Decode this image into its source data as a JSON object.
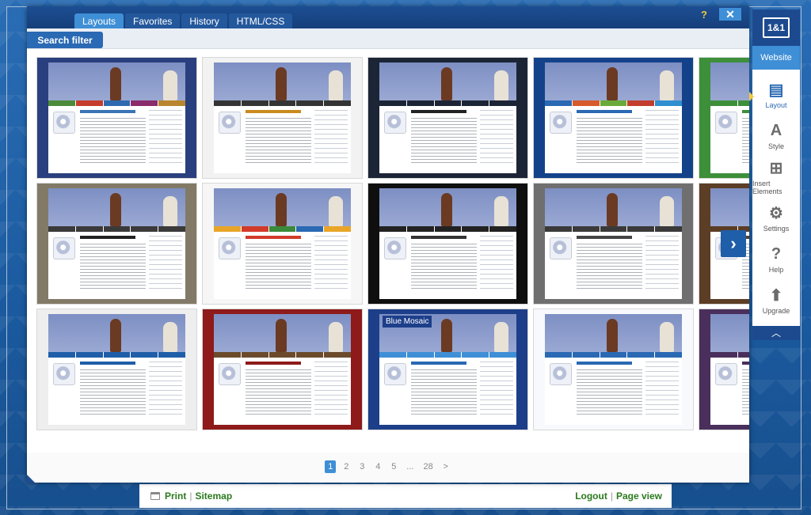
{
  "dialog": {
    "tabs": [
      {
        "label": "Layouts"
      },
      {
        "label": "Favorites"
      },
      {
        "label": "History"
      },
      {
        "label": "HTML/CSS"
      }
    ],
    "help_label": "?",
    "close_label": "✕",
    "search_filter_label": "Search filter",
    "next_arrow": "›"
  },
  "templates": [
    {
      "row": 0,
      "col": 0,
      "bg": "#2a3f7e",
      "nav": [
        "#4b8a3a",
        "#c43c2c",
        "#2f6ab0",
        "#8a2b6b",
        "#b7862e"
      ],
      "accent": "#3b74b5"
    },
    {
      "row": 0,
      "col": 1,
      "bg": "#f2f2f2",
      "nav": [
        "#343434",
        "#343434",
        "#343434",
        "#343434",
        "#343434"
      ],
      "accent": "#c98b1e"
    },
    {
      "row": 0,
      "col": 2,
      "bg": "#1c2536",
      "nav": [
        "#1c2536",
        "#1c2536",
        "#1c2536",
        "#1c2536",
        "#1c2536"
      ],
      "accent": "#222222"
    },
    {
      "row": 0,
      "col": 3,
      "bg": "#14428a",
      "nav": [
        "#2a69b3",
        "#d65a2b",
        "#6aaa3a",
        "#c23d2c",
        "#2f8fd0"
      ],
      "accent": "#2a69b3"
    },
    {
      "row": 0,
      "col": 4,
      "bg": "#3d8f3a",
      "nav": [
        "#3d8f3a",
        "#3d8f3a",
        "#3d8f3a",
        "#3d8f3a",
        "#3d8f3a"
      ],
      "accent": "#3d8f3a"
    },
    {
      "row": 1,
      "col": 0,
      "bg": "#827a67",
      "nav": [
        "#3a3a3a",
        "#3a3a3a",
        "#3a3a3a",
        "#3a3a3a",
        "#3a3a3a"
      ],
      "accent": "#222222"
    },
    {
      "row": 1,
      "col": 1,
      "bg": "#f6f6f6",
      "nav": [
        "#e8a528",
        "#d23a2a",
        "#3a8a3a",
        "#2a69b3",
        "#e8a528"
      ],
      "accent": "#d23a2a"
    },
    {
      "row": 1,
      "col": 2,
      "bg": "#0f0f0f",
      "nav": [
        "#222222",
        "#222222",
        "#222222",
        "#222222",
        "#222222"
      ],
      "accent": "#333333"
    },
    {
      "row": 1,
      "col": 3,
      "bg": "#6f6f6f",
      "nav": [
        "#3a3a3a",
        "#3a3a3a",
        "#3a3a3a",
        "#3a3a3a",
        "#3a3a3a"
      ],
      "accent": "#444444"
    },
    {
      "row": 1,
      "col": 4,
      "bg": "#5c3d25",
      "nav": [
        "#5c3d25",
        "#5c3d25",
        "#5c3d25",
        "#5c3d25",
        "#5c3d25"
      ],
      "accent": "#5c3d25"
    },
    {
      "row": 2,
      "col": 0,
      "bg": "#eeeeee",
      "nav": [
        "#1f5ea8",
        "#1f5ea8",
        "#1f5ea8",
        "#1f5ea8",
        "#1f5ea8"
      ],
      "accent": "#1f5ea8"
    },
    {
      "row": 2,
      "col": 1,
      "bg": "#8e1a1a",
      "nav": [
        "#6b4b2b",
        "#6b4b2b",
        "#6b4b2b",
        "#6b4b2b",
        "#6b4b2b"
      ],
      "accent": "#8e1a1a"
    },
    {
      "row": 2,
      "col": 2,
      "bg": "#1d3f8a",
      "nav": [
        "#3f8fd6",
        "#3f8fd6",
        "#3f8fd6",
        "#3f8fd6",
        "#3f8fd6"
      ],
      "accent": "#2a69b3",
      "name": "Blue Mosaic"
    },
    {
      "row": 2,
      "col": 3,
      "bg": "#f7f9fc",
      "nav": [
        "#2a69b3",
        "#2a69b3",
        "#2a69b3",
        "#2a69b3",
        "#2a69b3"
      ],
      "accent": "#2a69b3"
    },
    {
      "row": 2,
      "col": 4,
      "bg": "#4a2f5c",
      "nav": [
        "#4a2f5c",
        "#4a2f5c",
        "#4a2f5c",
        "#4a2f5c",
        "#4a2f5c"
      ],
      "accent": "#4a2f5c"
    }
  ],
  "pagination": {
    "pages": [
      "1",
      "2",
      "3",
      "4",
      "5",
      "...",
      "28",
      ">"
    ],
    "current": "1"
  },
  "footer": {
    "print_label": "Print",
    "sitemap_label": "Sitemap",
    "logout_label": "Logout",
    "pageview_label": "Page view",
    "separator": "|"
  },
  "sidebar": {
    "logo_text": "1&1",
    "website_label": "Website",
    "items": [
      {
        "label": "Layout",
        "icon": "layout-icon",
        "glyph": "▤",
        "active": true
      },
      {
        "label": "Style",
        "icon": "style-icon",
        "glyph": "A",
        "active": false
      },
      {
        "label": "Insert Elements",
        "icon": "insert-elements-icon",
        "glyph": "⊞",
        "active": false
      },
      {
        "label": "Settings",
        "icon": "settings-icon",
        "glyph": "⚙",
        "active": false
      },
      {
        "label": "Help",
        "icon": "help-icon",
        "glyph": "?",
        "active": false
      },
      {
        "label": "Upgrade",
        "icon": "upgrade-icon",
        "glyph": "⬆",
        "active": false
      }
    ],
    "collapse_glyph": "︿"
  }
}
